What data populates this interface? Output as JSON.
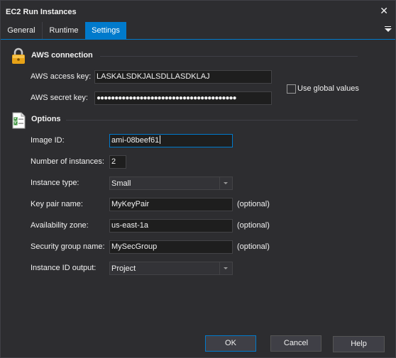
{
  "window": {
    "title": "EC2 Run Instances"
  },
  "tabs": [
    {
      "label": "General"
    },
    {
      "label": "Runtime"
    },
    {
      "label": "Settings",
      "active": true
    }
  ],
  "aws_connection": {
    "title": "AWS connection",
    "access_key_label": "AWS access key:",
    "access_key_value": "LASKALSDKJALSDLLASDKLAJ",
    "secret_key_label": "AWS secret key:",
    "secret_key_value": "●●●●●●●●●●●●●●●●●●●●●●●●●●●●●●●●●●●●●●●",
    "use_global_label": "Use global values",
    "use_global_checked": false
  },
  "options": {
    "title": "Options",
    "image_id_label": "Image ID:",
    "image_id_value": "ami-08beef61",
    "num_instances_label": "Number of instances:",
    "num_instances_value": "2",
    "instance_type_label": "Instance type:",
    "instance_type_value": "Small",
    "key_pair_label": "Key pair name:",
    "key_pair_value": "MyKeyPair",
    "availability_zone_label": "Availability zone:",
    "availability_zone_value": "us-east-1a",
    "security_group_label": "Security group name:",
    "security_group_value": "MySecGroup",
    "instance_id_output_label": "Instance ID output:",
    "instance_id_output_value": "Project",
    "optional_text": "(optional)"
  },
  "buttons": {
    "ok": "OK",
    "cancel": "Cancel",
    "help": "Help"
  },
  "colors": {
    "background": "#2d2d30",
    "accent": "#007acc",
    "input_bg": "#1e1e1e",
    "text": "#f1f1f1"
  },
  "icons": {
    "close": "close-icon",
    "tab_menu": "tab-menu-icon",
    "aws": "lock-icon",
    "options": "checklist-icon"
  }
}
